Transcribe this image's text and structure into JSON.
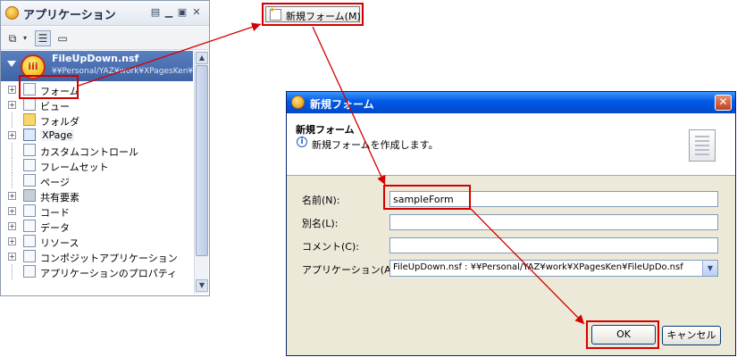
{
  "app_panel": {
    "title": "アプリケーション",
    "header_icons": [
      "view-menu-icon",
      "minimize-icon",
      "maximize-icon",
      "close-icon"
    ],
    "toolbar_icons": [
      "new-design-icon",
      "dropdown-icon",
      "tree-view-icon",
      "list-view-icon"
    ],
    "database": {
      "name": "FileUpDown.nsf",
      "path": "¥¥Personal/YAZ¥work¥XPagesKen¥FileUpDo"
    },
    "tree": [
      {
        "label": "フォーム",
        "icon": "form-icon",
        "expandable": true
      },
      {
        "label": "ビュー",
        "icon": "view-icon",
        "expandable": true
      },
      {
        "label": "フォルダ",
        "icon": "folder-icon",
        "expandable": false
      },
      {
        "label": "XPage",
        "icon": "xpage-icon",
        "expandable": true
      },
      {
        "label": "カスタムコントロール",
        "icon": "custom-control-icon",
        "expandable": false
      },
      {
        "label": "フレームセット",
        "icon": "frameset-icon",
        "expandable": false
      },
      {
        "label": "ページ",
        "icon": "page-icon",
        "expandable": false
      },
      {
        "label": "共有要素",
        "icon": "shared-elements-icon",
        "expandable": true
      },
      {
        "label": "コード",
        "icon": "code-icon",
        "expandable": true
      },
      {
        "label": "データ",
        "icon": "data-icon",
        "expandable": true
      },
      {
        "label": "リソース",
        "icon": "resources-icon",
        "expandable": true
      },
      {
        "label": "コンポジットアプリケーション",
        "icon": "composite-app-icon",
        "expandable": true
      },
      {
        "label": "アプリケーションのプロパティ",
        "icon": "app-properties-icon",
        "expandable": false
      }
    ]
  },
  "menu_button": {
    "label": "新規フォーム(M)"
  },
  "dialog": {
    "title": "新規フォーム",
    "banner_title": "新規フォーム",
    "banner_description": "新規フォームを作成します。",
    "fields": {
      "name_label": "名前(N):",
      "name_value": "sampleForm",
      "alias_label": "別名(L):",
      "alias_value": "",
      "comment_label": "コメント(C):",
      "comment_value": "",
      "application_label": "アプリケーション(A):",
      "application_value": "FileUpDown.nsf : ¥¥Personal/YAZ¥work¥XPagesKen¥FileUpDo.nsf"
    },
    "buttons": {
      "ok": "OK",
      "cancel": "キャンセル"
    }
  },
  "colors": {
    "annotation": "#d40000",
    "titlebar": "#0058e6",
    "selected_db": "#3e64a6"
  }
}
